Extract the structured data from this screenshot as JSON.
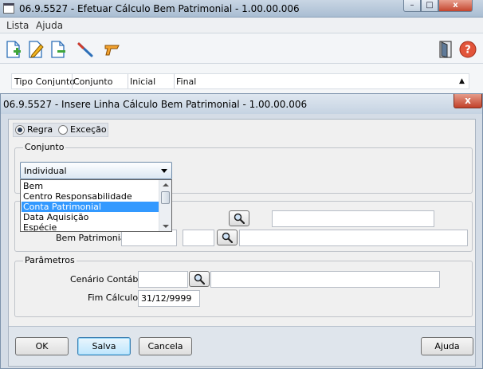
{
  "back_window": {
    "title": "06.9.5527 - Efetuar Cálculo Bem Patrimonial - 1.00.00.006",
    "menu": [
      "Lista",
      "Ajuda"
    ],
    "toolbar_icons": [
      "add-record-icon",
      "edit-record-icon",
      "remove-record-icon",
      "clear-icon",
      "execute-icon",
      "exit-door-icon",
      "help-icon"
    ],
    "grid_columns": [
      "Tipo Conjunto",
      "Conjunto",
      "Inicial",
      "Final"
    ],
    "help_glyph": "?"
  },
  "dialog": {
    "title": "06.9.5527 - Insere Linha Cálculo Bem Patrimonial - 1.00.00.006",
    "close_glyph": "x",
    "radio_regra": "Regra",
    "radio_excecao": "Exceção",
    "conjunto_group": "Conjunto",
    "combo_value": "Individual",
    "dropdown_options": [
      "Bem",
      "Centro Responsabilidade",
      "Conta Patrimonial",
      "Data Aquisição",
      "Espécie"
    ],
    "dropdown_selected_index": 2,
    "bem_patrimonial_label": "Bem Patrimonial:",
    "bem_patrimonial_value": "",
    "bem_patrimonial_value2": "",
    "bem_patrimonial_desc": "",
    "parametros_group": "Parâmetros",
    "cenario_label": "Cenário Contábil:",
    "cenario_value": "",
    "cenario_desc": "",
    "fim_calculo_label": "Fim Cálculo:",
    "fim_calculo_value": "31/12/9999",
    "buttons": {
      "ok": "OK",
      "salva": "Salva",
      "cancela": "Cancela",
      "ajuda": "Ajuda"
    }
  },
  "colors": {
    "dropdown_highlight": "#3399ff",
    "window_frame": "#b9c9da"
  }
}
